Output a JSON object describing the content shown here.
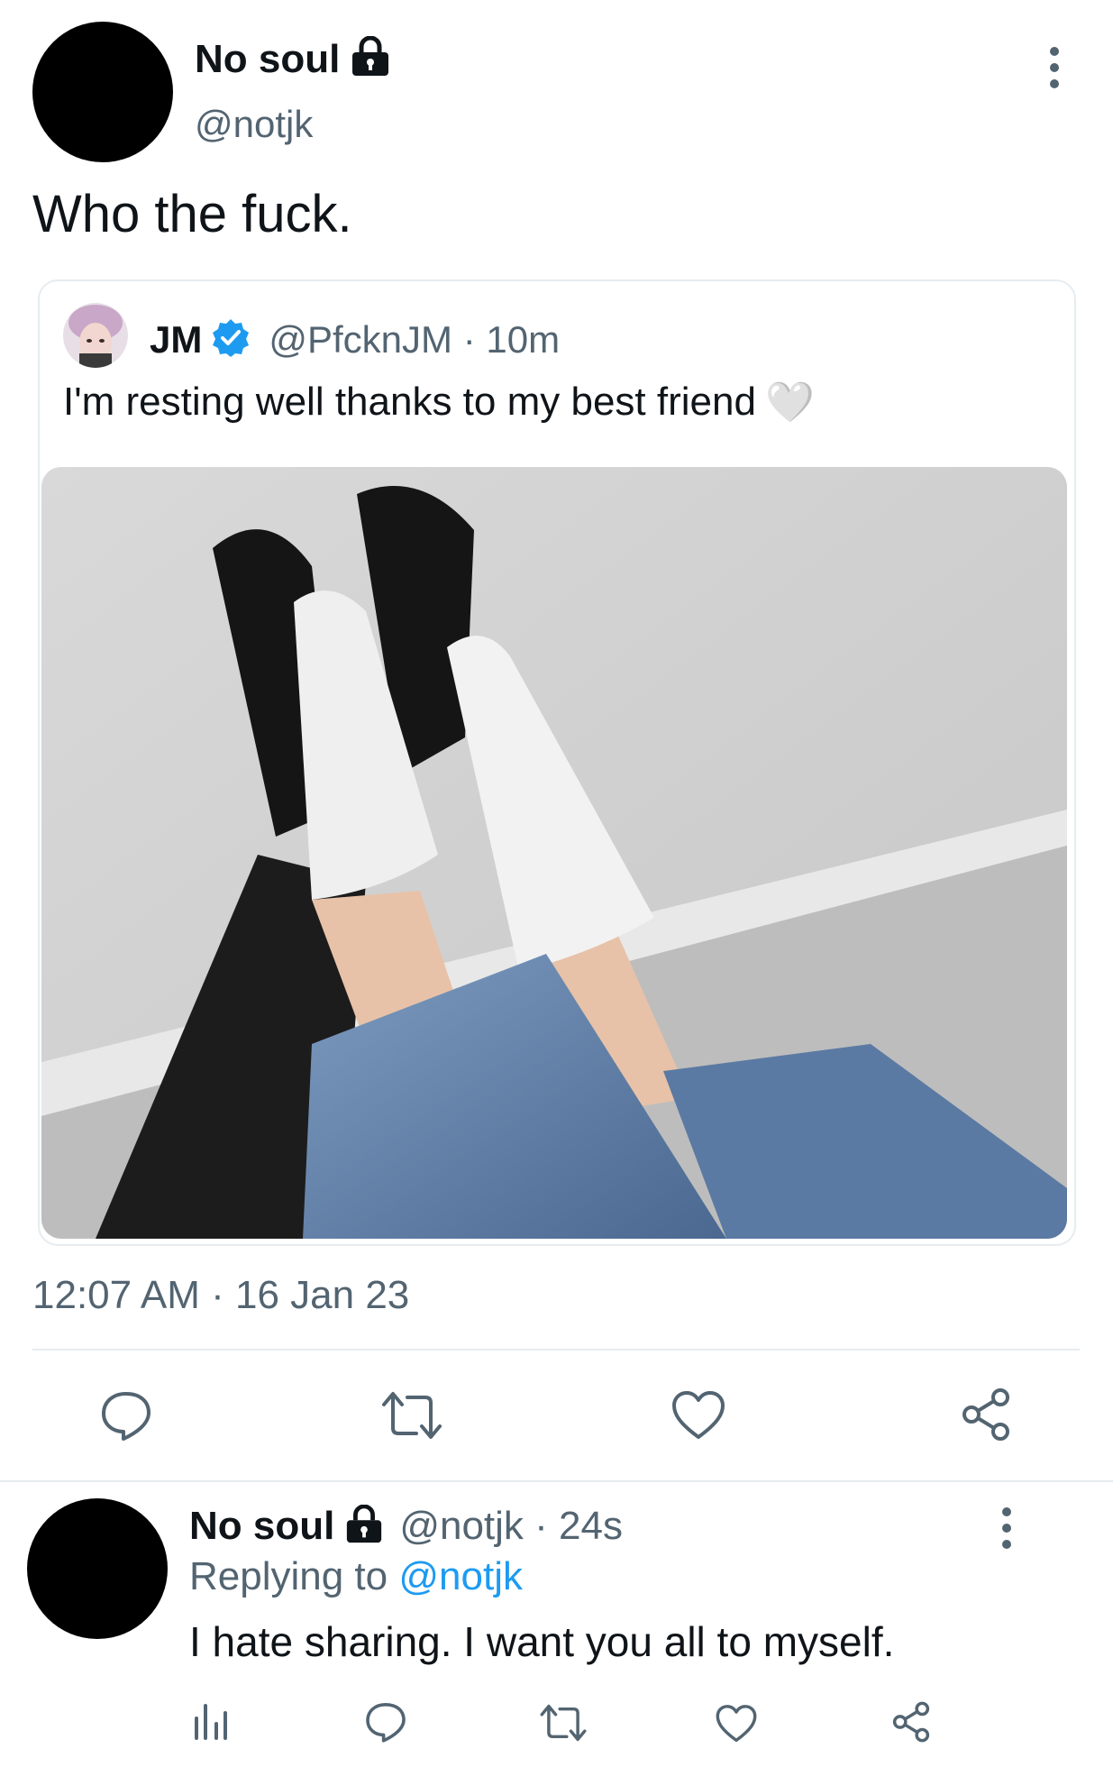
{
  "main_tweet": {
    "display_name": "No soul",
    "handle": "@notjk",
    "text": "Who the fuck.",
    "timestamp": "12:07 AM · 16 Jan 23",
    "icons": {
      "lock": "lock-icon",
      "more": "more-vertical-icon"
    }
  },
  "quoted_tweet": {
    "display_name": "JM",
    "handle_time": "@PfcknJM · 10m",
    "text": "I'm resting well thanks to my best friend",
    "emoji": "🤍",
    "verified_icon": "verified-badge-icon"
  },
  "actions": [
    "reply-icon",
    "retweet-icon",
    "like-icon",
    "share-icon"
  ],
  "reply_tweet": {
    "display_name": "No soul",
    "handle_time": "@notjk · 24s",
    "replying_prefix": "Replying to",
    "replying_handle": "@notjk",
    "text": "I hate sharing. I want you all to myself.",
    "actions": [
      "analytics-icon",
      "reply-icon",
      "retweet-icon",
      "like-icon",
      "share-icon"
    ]
  },
  "colors": {
    "accent": "#1d9bf0",
    "text": "#0f1419",
    "secondary": "#536471",
    "divider": "#e6ecf0"
  }
}
